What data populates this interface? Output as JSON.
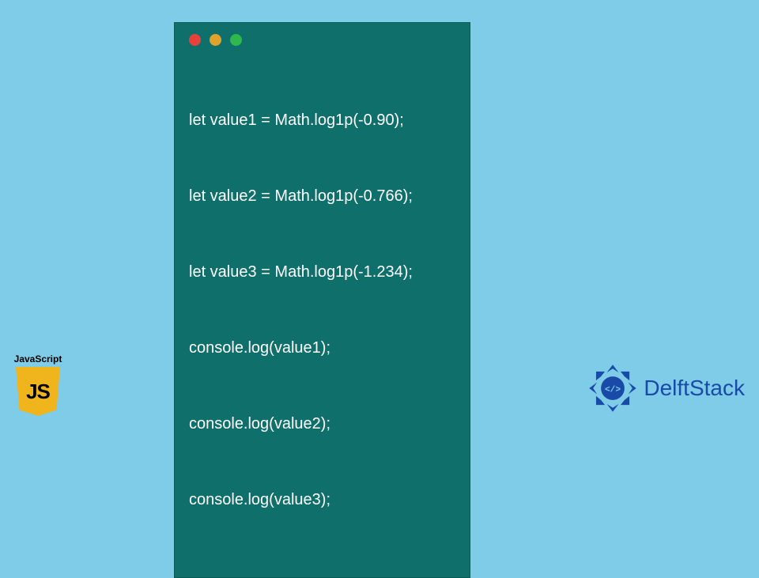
{
  "code_card": {
    "traffic_colors": [
      "#e8413b",
      "#e0a22a",
      "#2fb84b"
    ],
    "lines": [
      "let value1 = Math.log1p(-0.90);",
      "let value2 = Math.log1p(-0.766);",
      "let value3 = Math.log1p(-1.234);",
      "console.log(value1);",
      "console.log(value2);",
      "console.log(value3);"
    ]
  },
  "js_badge": {
    "label": "JavaScript",
    "shield_text": "JS"
  },
  "brand": {
    "name": "DelftStack",
    "accent": "#1a4aa8"
  }
}
